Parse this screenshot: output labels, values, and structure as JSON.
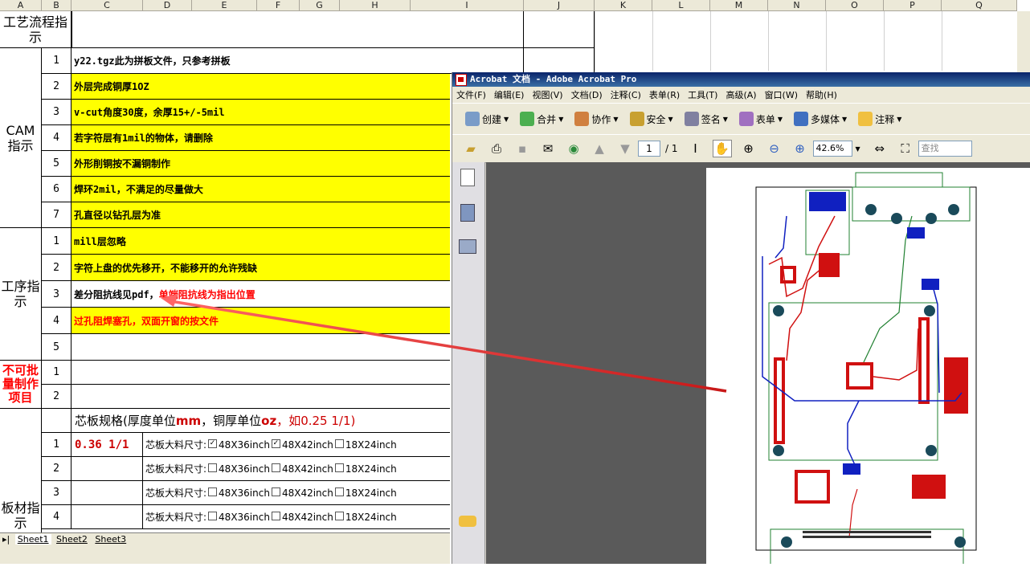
{
  "sheet": {
    "columns": [
      "A",
      "B",
      "C",
      "D",
      "E",
      "F",
      "G",
      "H",
      "I",
      "J",
      "K",
      "L",
      "M",
      "N",
      "O",
      "P",
      "Q"
    ],
    "sections": {
      "process_guide": "工艺流程指示",
      "cam_guide": "CAM指示",
      "step_guide": "工序指示",
      "non_batch": "不可批量制作项目",
      "board_guide": "板材指示"
    },
    "cam_rows": [
      {
        "num": "1",
        "text": "y22.tgz此为拼板文件，只参考拼板"
      },
      {
        "num": "2",
        "text": "外层完成铜厚1OZ"
      },
      {
        "num": "3",
        "text": "v-cut角度30度，余厚15+/-5mil"
      },
      {
        "num": "4",
        "text": "若字符层有1mil的物体，请删除"
      },
      {
        "num": "5",
        "text": "外形削铜按不漏铜制作"
      },
      {
        "num": "6",
        "text": "焊环2mil，不满足的尽量做大"
      },
      {
        "num": "7",
        "text": "孔直径以钻孔层为准"
      }
    ],
    "step_rows": [
      {
        "num": "1",
        "text": "mill层忽略"
      },
      {
        "num": "2",
        "text": "字符上盘的优先移开，不能移开的允许残缺"
      },
      {
        "num": "3",
        "text_a": "差分阻抗线见pdf，",
        "text_b": "单端阻抗线为指出位置"
      },
      {
        "num": "4",
        "text": "过孔阻焊塞孔，双面开窗的按文件"
      },
      {
        "num": "5",
        "text": ""
      }
    ],
    "nonbatch_rows": [
      {
        "num": "1"
      },
      {
        "num": "2"
      }
    ],
    "core_spec": {
      "a": "芯板规格(厚度单位",
      "b": "mm",
      "c": "，铜厚单位",
      "d": "oz",
      "e": "，如0.25 1/1)"
    },
    "board_rows": [
      {
        "num": "1",
        "spec": "0.36 1/1",
        "label": "芯板大料尺寸:",
        "opt1": "48X36inch",
        "opt2": "48X42inch",
        "opt3": "18X24inch",
        "c1": true,
        "c2": true,
        "c3": false
      },
      {
        "num": "2",
        "spec": "",
        "label": "芯板大料尺寸:",
        "opt1": "48X36inch",
        "opt2": "48X42inch",
        "opt3": "18X24inch",
        "c1": false,
        "c2": false,
        "c3": false
      },
      {
        "num": "3",
        "spec": "",
        "label": "芯板大料尺寸:",
        "opt1": "48X36inch",
        "opt2": "48X42inch",
        "opt3": "18X24inch",
        "c1": false,
        "c2": false,
        "c3": false
      },
      {
        "num": "4",
        "spec": "",
        "label": "芯板大料尺寸:",
        "opt1": "48X36inch",
        "opt2": "48X42inch",
        "opt3": "18X24inch",
        "c1": false,
        "c2": false,
        "c3": false
      }
    ],
    "tabs": [
      "Sheet1",
      "Sheet2",
      "Sheet3"
    ]
  },
  "acrobat": {
    "title": "Acrobat 文档 - Adobe Acrobat Pro",
    "menu": [
      "文件(F)",
      "编辑(E)",
      "视图(V)",
      "文档(D)",
      "注释(C)",
      "表单(R)",
      "工具(T)",
      "高级(A)",
      "窗口(W)",
      "帮助(H)"
    ],
    "toolbar": [
      "创建",
      "合并",
      "协作",
      "安全",
      "签名",
      "表单",
      "多媒体",
      "注释"
    ],
    "page_current": "1",
    "page_total": "/ 1",
    "zoom": "42.6%",
    "search_placeholder": "查找"
  },
  "colors": {
    "highlight": "#ffff00",
    "red_text": "#ff0000",
    "annotation_arrow": "#e05555",
    "pcb_red": "#d01010",
    "pcb_blue": "#1020c0",
    "pcb_green": "#208030"
  }
}
